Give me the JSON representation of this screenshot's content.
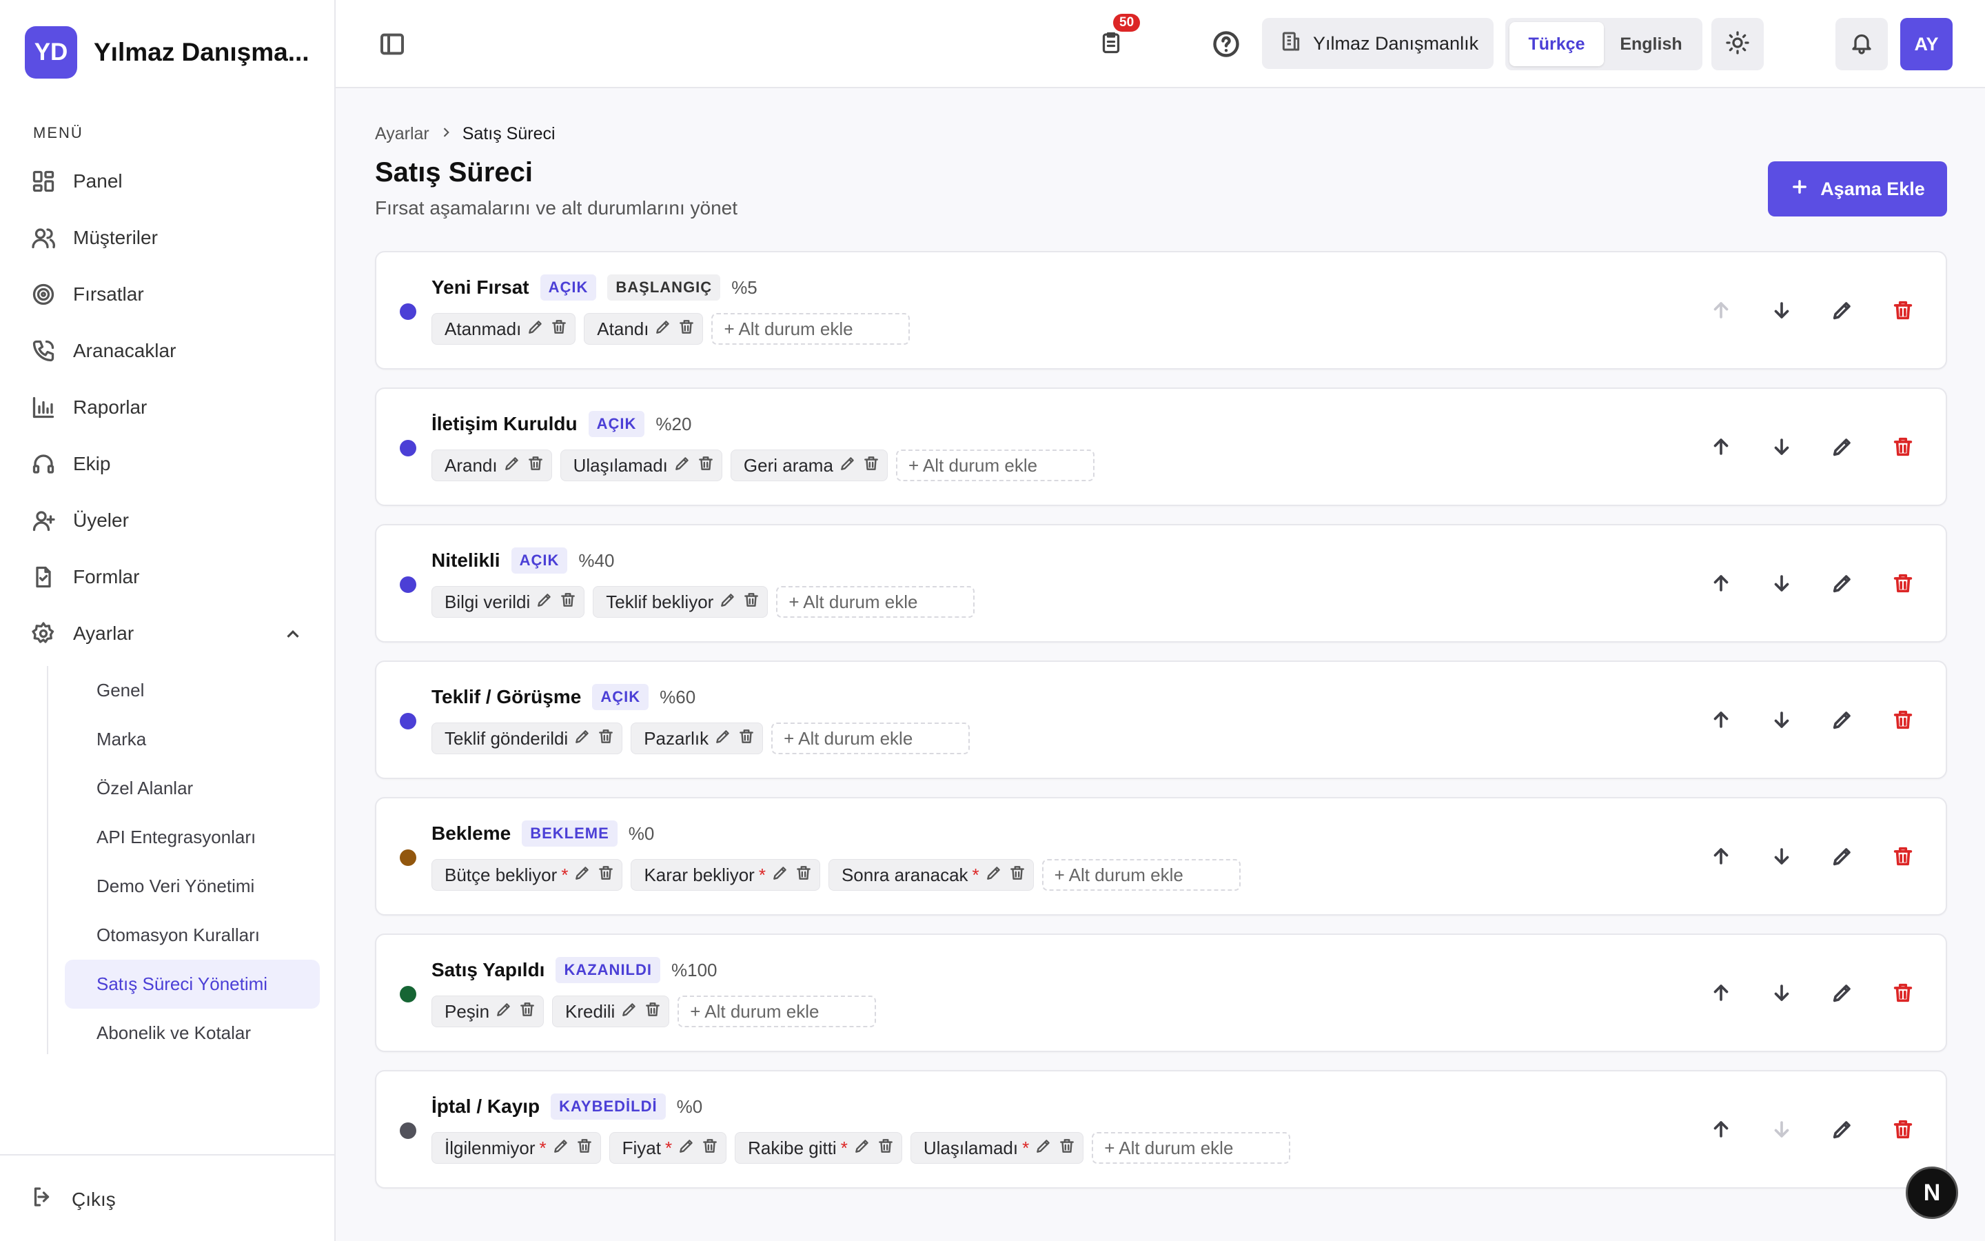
{
  "brand": {
    "logo": "YD",
    "name": "Yılmaz Danışma..."
  },
  "sidebar": {
    "menu_title": "MENÜ",
    "items": [
      {
        "label": "Panel",
        "icon": "grid-icon"
      },
      {
        "label": "Müşteriler",
        "icon": "users-icon"
      },
      {
        "label": "Fırsatlar",
        "icon": "target-icon"
      },
      {
        "label": "Aranacaklar",
        "icon": "phone-icon"
      },
      {
        "label": "Raporlar",
        "icon": "bar-chart-icon"
      },
      {
        "label": "Ekip",
        "icon": "headset-icon"
      },
      {
        "label": "Üyeler",
        "icon": "user-icon"
      },
      {
        "label": "Formlar",
        "icon": "form-icon"
      },
      {
        "label": "Ayarlar",
        "icon": "gear-icon"
      }
    ],
    "sub_items": [
      {
        "label": "Genel",
        "active": false
      },
      {
        "label": "Marka",
        "active": false
      },
      {
        "label": "Özel Alanlar",
        "active": false
      },
      {
        "label": "API Entegrasyonları",
        "active": false
      },
      {
        "label": "Demo Veri Yönetimi",
        "active": false
      },
      {
        "label": "Otomasyon Kuralları",
        "active": false
      },
      {
        "label": "Satış Süreci Yönetimi",
        "active": true
      },
      {
        "label": "Abonelik ve Kotalar",
        "active": false
      }
    ],
    "logout": "Çıkış"
  },
  "topbar": {
    "org": "Yılmaz Danışmanlık",
    "lang_tr": "Türkçe",
    "lang_en": "English",
    "tasks_badge": "50",
    "avatar": "AY"
  },
  "page": {
    "breadcrumb_parent": "Ayarlar",
    "breadcrumb_current": "Satış Süreci",
    "title": "Satış Süreci",
    "subtitle": "Fırsat aşamalarını ve alt durumlarını yönet",
    "add_stage": "Aşama Ekle",
    "add_sub_label": "+ Alt durum ekle"
  },
  "colors": {
    "accent": "#5b4ee3",
    "open": "#4b3fd6",
    "waiting": "#92570e",
    "won": "#166534",
    "lost": "#52525b",
    "danger": "#dc2626"
  },
  "stages": [
    {
      "name": "Yeni Fırsat",
      "status": "AÇIK",
      "tag": "BAŞLANGIÇ",
      "pct": "%5",
      "color": "#4b3fd6",
      "up_disabled": true,
      "down_disabled": false,
      "subs": [
        {
          "label": "Atanmadı",
          "req": false
        },
        {
          "label": "Atandı",
          "req": false
        }
      ]
    },
    {
      "name": "İletişim Kuruldu",
      "status": "AÇIK",
      "tag": "",
      "pct": "%20",
      "color": "#4b3fd6",
      "up_disabled": false,
      "down_disabled": false,
      "subs": [
        {
          "label": "Arandı",
          "req": false
        },
        {
          "label": "Ulaşılamadı",
          "req": false
        },
        {
          "label": "Geri arama",
          "req": false
        }
      ]
    },
    {
      "name": "Nitelikli",
      "status": "AÇIK",
      "tag": "",
      "pct": "%40",
      "color": "#4b3fd6",
      "up_disabled": false,
      "down_disabled": false,
      "subs": [
        {
          "label": "Bilgi verildi",
          "req": false
        },
        {
          "label": "Teklif bekliyor",
          "req": false
        }
      ]
    },
    {
      "name": "Teklif / Görüşme",
      "status": "AÇIK",
      "tag": "",
      "pct": "%60",
      "color": "#4b3fd6",
      "up_disabled": false,
      "down_disabled": false,
      "subs": [
        {
          "label": "Teklif gönderildi",
          "req": false
        },
        {
          "label": "Pazarlık",
          "req": false
        }
      ]
    },
    {
      "name": "Bekleme",
      "status": "BEKLEME",
      "tag": "",
      "pct": "%0",
      "color": "#92570e",
      "up_disabled": false,
      "down_disabled": false,
      "subs": [
        {
          "label": "Bütçe bekliyor",
          "req": true
        },
        {
          "label": "Karar bekliyor",
          "req": true
        },
        {
          "label": "Sonra aranacak",
          "req": true
        }
      ]
    },
    {
      "name": "Satış Yapıldı",
      "status": "KAZANILDI",
      "tag": "",
      "pct": "%100",
      "color": "#166534",
      "up_disabled": false,
      "down_disabled": false,
      "subs": [
        {
          "label": "Peşin",
          "req": false
        },
        {
          "label": "Kredili",
          "req": false
        }
      ]
    },
    {
      "name": "İptal / Kayıp",
      "status": "KAYBEDİLDİ",
      "tag": "",
      "pct": "%0",
      "color": "#52525b",
      "up_disabled": false,
      "down_disabled": true,
      "subs": [
        {
          "label": "İlgilenmiyor",
          "req": true
        },
        {
          "label": "Fiyat",
          "req": true
        },
        {
          "label": "Rakibe gitti",
          "req": true
        },
        {
          "label": "Ulaşılamadı",
          "req": true
        }
      ]
    }
  ],
  "fab": "N"
}
